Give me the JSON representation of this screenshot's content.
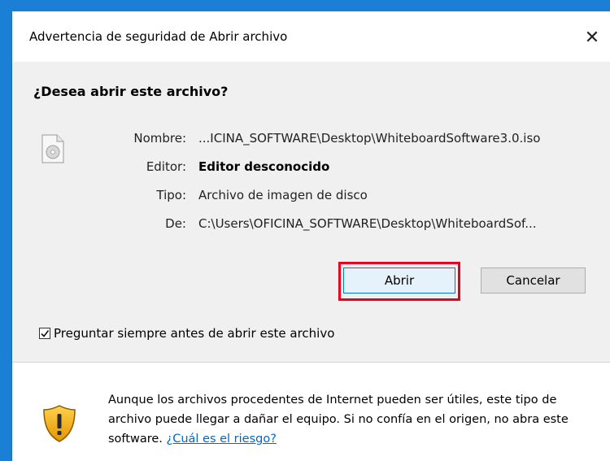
{
  "dialog": {
    "title": "Advertencia de seguridad de Abrir archivo",
    "close_label": "✕",
    "heading": "¿Desea abrir este archivo?"
  },
  "details": {
    "name_label": "Nombre:",
    "name_value": "...ICINA_SOFTWARE\\Desktop\\WhiteboardSoftware3.0.iso",
    "publisher_label": "Editor:",
    "publisher_value": "Editor desconocido",
    "type_label": "Tipo:",
    "type_value": "Archivo de imagen de disco",
    "from_label": "De:",
    "from_value": "C:\\Users\\OFICINA_SOFTWARE\\Desktop\\WhiteboardSof..."
  },
  "buttons": {
    "open_label": "Abrir",
    "cancel_label": "Cancelar"
  },
  "checkbox": {
    "label": "Preguntar siempre antes de abrir este archivo",
    "checked": true
  },
  "footer": {
    "warning_text": "Aunque los archivos procedentes de Internet pueden ser útiles, este tipo de archivo puede llegar a dañar el equipo. Si no confía en el origen, no abra este software.",
    "risk_link": "¿Cuál es el riesgo?"
  },
  "colors": {
    "highlight": "#e8001c",
    "accent": "#0078d7",
    "link": "#0066cc"
  }
}
